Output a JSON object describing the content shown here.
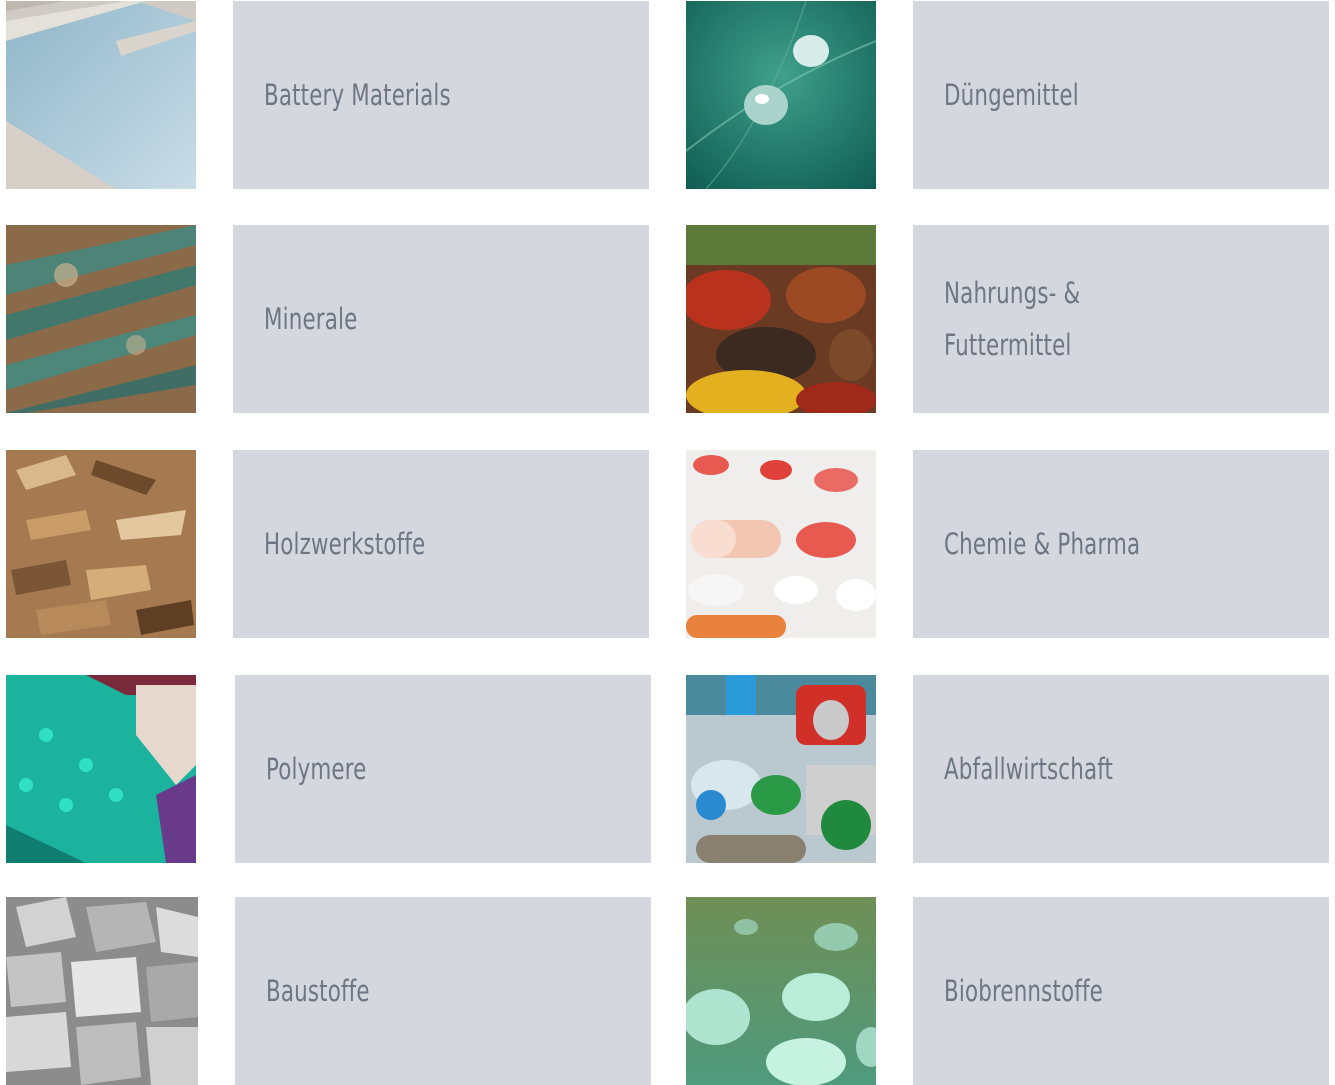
{
  "categories": [
    {
      "label": "Battery Materials",
      "image": "salt-evaporation-pond"
    },
    {
      "label": "Düngemittel",
      "image": "water-droplets-on-leaf"
    },
    {
      "label": "Minerale",
      "image": "mineral-rock-surface"
    },
    {
      "label": "Nahrungs- &\nFuttermittel",
      "image": "spices"
    },
    {
      "label": "Holzwerkstoffe",
      "image": "wood-chips"
    },
    {
      "label": "Chemie & Pharma",
      "image": "pills"
    },
    {
      "label": "Polymere",
      "image": "plastic-pellets"
    },
    {
      "label": "Abfallwirtschaft",
      "image": "recycling-waste"
    },
    {
      "label": "Baustoffe",
      "image": "construction-aggregates"
    },
    {
      "label": "Biobrennstoffe",
      "image": "bio-oil-droplets"
    }
  ]
}
